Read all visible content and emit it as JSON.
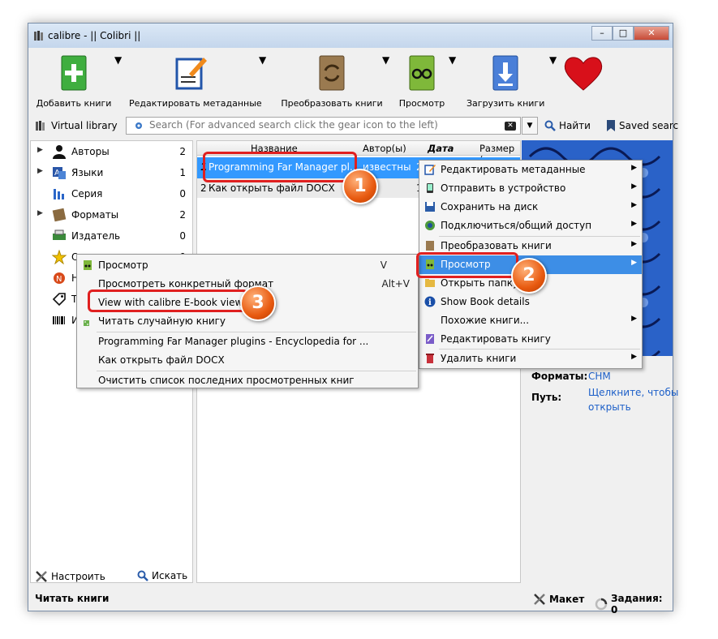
{
  "window": {
    "title": "calibre - || Colibri ||",
    "min": "–",
    "max": "□",
    "close": "✕"
  },
  "toolbar": {
    "add": "Добавить книги",
    "edit_meta": "Редактировать метаданные",
    "convert": "Преобразовать книги",
    "view": "Просмотр",
    "download": "Загрузить книги"
  },
  "searchbar": {
    "virtual_library": "Virtual library",
    "placeholder": "Search (For advanced search click the gear icon to the left)",
    "find": "Найти",
    "saved": "Saved searc"
  },
  "tree": [
    {
      "label": "Авторы",
      "count": "2",
      "icon": "person-icon"
    },
    {
      "label": "Языки",
      "count": "1",
      "icon": "language-icon"
    },
    {
      "label": "Серия",
      "count": "0",
      "icon": "series-icon"
    },
    {
      "label": "Форматы",
      "count": "2",
      "icon": "formats-icon"
    },
    {
      "label": "Издатель",
      "count": "0",
      "icon": "publisher-icon"
    },
    {
      "label": "О",
      "count": "0",
      "icon": "star-icon"
    },
    {
      "label": "Н",
      "count": "",
      "icon": "news-icon"
    },
    {
      "label": "Т",
      "count": "",
      "icon": "tag-icon"
    },
    {
      "label": "И",
      "count": "",
      "icon": "barcode-icon"
    }
  ],
  "left_bottom": {
    "configure": "Настроить",
    "search": "Искать"
  },
  "booklist": {
    "headers": {
      "title": "Название",
      "author": "Автор(ы)",
      "date": "Дата",
      "size": "Размер ("
    },
    "rows": [
      {
        "num": "1",
        "title": "Programming Far Manager pl...",
        "author": "известный",
        "extra": "2"
      },
      {
        "num": "2",
        "title": "Как открыть файл DOCX",
        "author": "",
        "extra": "1"
      }
    ]
  },
  "details": {
    "formats_label": "Форматы:",
    "formats_value": "CHM",
    "path_label": "Путь:",
    "path_value_1": "Щелкните, чтобы",
    "path_value_2": "открыть"
  },
  "status": {
    "left": "Читать книги",
    "layout": "Макет",
    "jobs": "Задания: 0"
  },
  "context_menu": [
    {
      "label": "Редактировать метаданные",
      "arrow": true
    },
    {
      "label": "Отправить в устройство",
      "arrow": true
    },
    {
      "label": "Сохранить на диск",
      "arrow": true
    },
    {
      "label": "Подключиться/общий доступ",
      "arrow": true
    },
    {
      "label": "Преобразовать книги",
      "arrow": true
    },
    {
      "label": "Просмотр",
      "arrow": true
    },
    {
      "label": "Открыть папку",
      "arrow": false
    },
    {
      "label": "Show Book details",
      "arrow": false
    },
    {
      "label": "Похожие книги...",
      "arrow": true
    },
    {
      "label": "Редактировать книгу",
      "arrow": false
    },
    {
      "label": "Удалить книги",
      "arrow": true
    }
  ],
  "submenu": [
    {
      "label": "Просмотр",
      "shortcut": "V"
    },
    {
      "label": "Просмотреть конкретный формат",
      "shortcut": "Alt+V"
    },
    {
      "label": "View with calibre E-book viewer",
      "shortcut": ""
    },
    {
      "label": "Читать случайную книгу",
      "shortcut": ""
    },
    {
      "label": "Programming Far Manager plugins - Encyclopedia for ...",
      "shortcut": ""
    },
    {
      "label": "Как открыть файл DOCX",
      "shortcut": ""
    },
    {
      "label": "Очистить список последних просмотренных книг",
      "shortcut": ""
    }
  ],
  "badges": {
    "one": "1",
    "two": "2",
    "three": "3"
  },
  "colors": {
    "selection": "#3399ff",
    "highlight_box": "#e02020",
    "badge": "#e85a10"
  }
}
